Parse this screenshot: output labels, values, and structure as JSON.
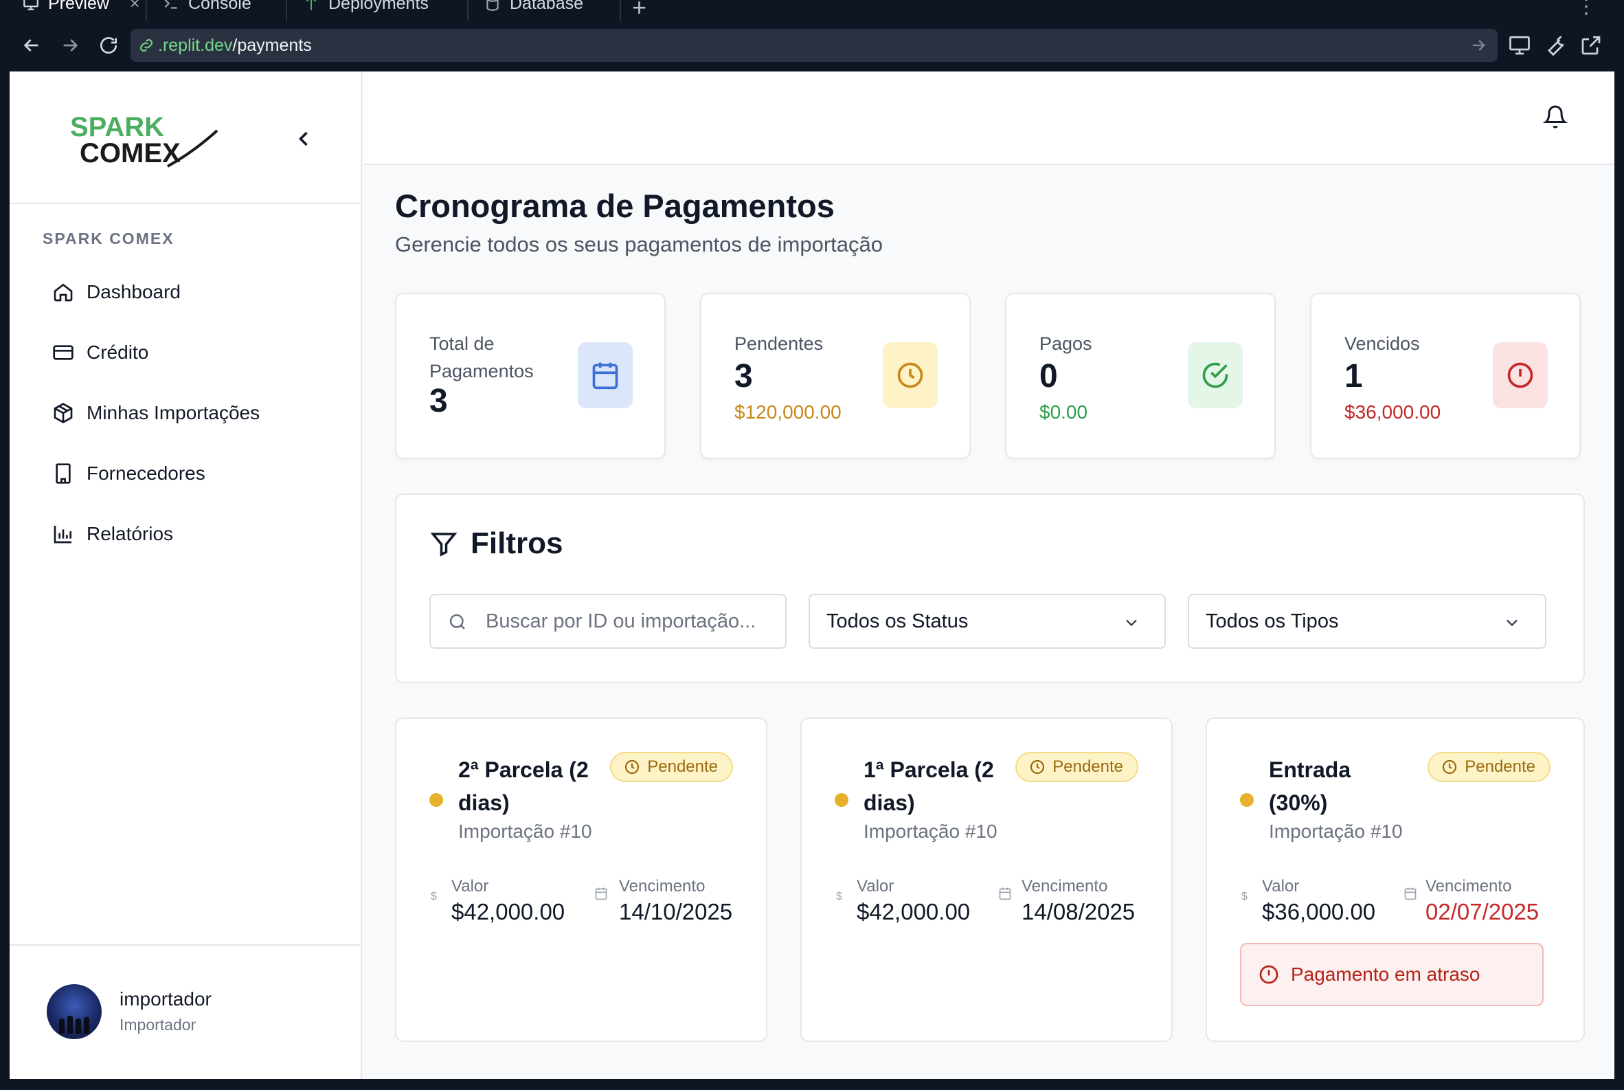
{
  "browser": {
    "tabs": [
      {
        "label": "Preview",
        "icon": "monitor-icon"
      },
      {
        "label": "Console",
        "icon": "terminal-icon"
      },
      {
        "label": "Deployments",
        "icon": "deploy-icon"
      },
      {
        "label": "Database",
        "icon": "database-icon"
      }
    ],
    "close_glyph": "×",
    "new_tab_glyph": "+",
    "url_host": ".replit.dev",
    "url_path": "/payments"
  },
  "sidebar": {
    "section_label": "SPARK COMEX",
    "items": [
      {
        "label": "Dashboard",
        "icon": "home-icon"
      },
      {
        "label": "Crédito",
        "icon": "credit-card-icon"
      },
      {
        "label": "Minhas Importações",
        "icon": "package-icon"
      },
      {
        "label": "Fornecedores",
        "icon": "building-icon"
      },
      {
        "label": "Relatórios",
        "icon": "bar-chart-icon"
      }
    ],
    "user": {
      "name": "importador",
      "role": "Importador"
    }
  },
  "logo": {
    "line1": "SPARK",
    "line2": "COMEX"
  },
  "page": {
    "title": "Cronograma de Pagamentos",
    "subtitle": "Gerencie todos os seus pagamentos de importação"
  },
  "stats": [
    {
      "label": "Total de Pagamentos",
      "value": "3",
      "amount": "",
      "icon": "calendar-icon",
      "color": "#3b6fd8",
      "bg": "#dbe6fb"
    },
    {
      "label": "Pendentes",
      "value": "3",
      "amount": "$120,000.00",
      "icon": "clock-icon",
      "color": "#c9881a",
      "bg": "#fdf3c6"
    },
    {
      "label": "Pagos",
      "value": "0",
      "amount": "$0.00",
      "icon": "check-circle-icon",
      "color": "#2f9d4a",
      "bg": "#e3f6e7"
    },
    {
      "label": "Vencidos",
      "value": "1",
      "amount": "$36,000.00",
      "icon": "alert-circle-icon",
      "color": "#c62828",
      "bg": "#fbe3e3"
    }
  ],
  "filters": {
    "title": "Filtros",
    "search_placeholder": "Buscar por ID ou importação...",
    "status_value": "Todos os Status",
    "type_value": "Todos os Tipos"
  },
  "payments": [
    {
      "title": "2ª Parcela (2 dias)",
      "import_ref": "Importação #10",
      "status": "Pendente",
      "value_label": "Valor",
      "value": "$42,000.00",
      "due_label": "Vencimento",
      "due": "14/10/2025",
      "overdue": false
    },
    {
      "title": "1ª Parcela (2 dias)",
      "import_ref": "Importação #10",
      "status": "Pendente",
      "value_label": "Valor",
      "value": "$42,000.00",
      "due_label": "Vencimento",
      "due": "14/08/2025",
      "overdue": false
    },
    {
      "title": "Entrada (30%)",
      "import_ref": "Importação #10",
      "status": "Pendente",
      "value_label": "Valor",
      "value": "$36,000.00",
      "due_label": "Vencimento",
      "due": "02/07/2025",
      "overdue": true,
      "alert": "Pagamento em atraso"
    }
  ],
  "colors": {
    "accent_green": "#2f9d4a",
    "pending": "#e8b12c",
    "overdue": "#c62828"
  }
}
